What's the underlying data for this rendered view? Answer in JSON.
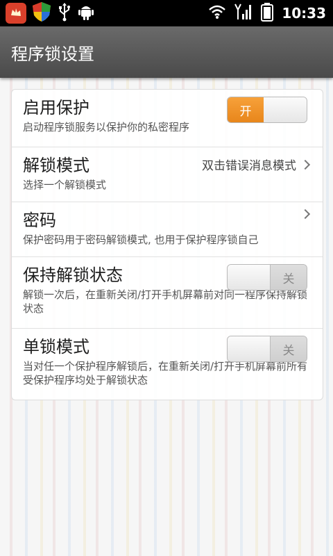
{
  "status_bar": {
    "time": "10:33",
    "icons": [
      "app-badge-icon",
      "shield-icon",
      "usb-icon",
      "android-icon",
      "wifi-icon",
      "signal-icon",
      "battery-icon"
    ]
  },
  "title_bar": {
    "title": "程序锁设置"
  },
  "settings": {
    "items": [
      {
        "title": "启用保护",
        "summary": "启动程序锁服务以保护你的私密程序",
        "toggle_label": "开",
        "toggle_state": "on"
      },
      {
        "title": "解锁模式",
        "summary": "选择一个解锁模式",
        "value": "双击错误消息模式"
      },
      {
        "title": "密码",
        "summary": "保护密码用于密码解锁模式, 也用于保护程序锁自己"
      },
      {
        "title": "保持解锁状态",
        "summary": "解锁一次后，在重新关闭/打开手机屏幕前对同一程序保持解锁状态",
        "toggle_label": "关",
        "toggle_state": "off"
      },
      {
        "title": "单锁模式",
        "summary": "当对任一个保护程序解锁后，在重新关闭/打开手机屏幕前所有受保护程序均处于解锁状态",
        "toggle_label": "关",
        "toggle_state": "off"
      }
    ]
  },
  "colors": {
    "accent": "#e8861b",
    "title_bar": "#555555"
  }
}
